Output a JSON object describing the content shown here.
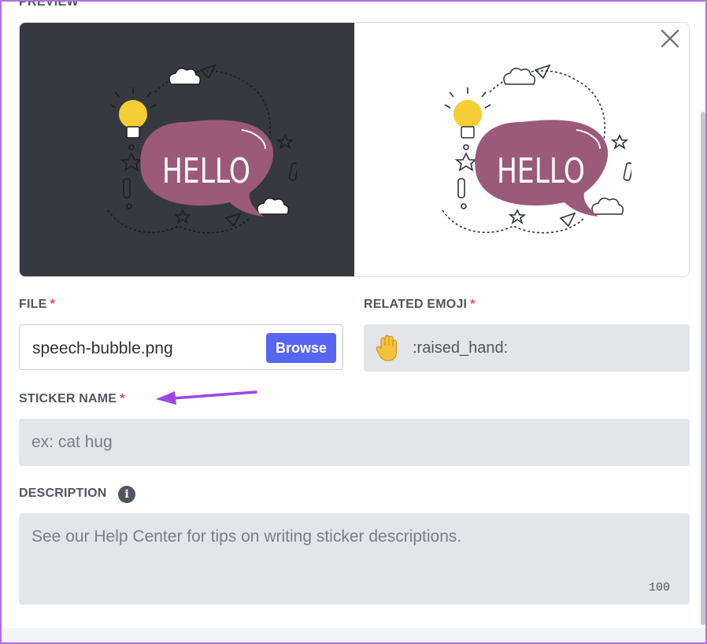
{
  "preview": {
    "heading": "PREVIEW",
    "sticker_text": "HELLO",
    "sticker_color": "#9b5a7a",
    "dark_background": "#36393f",
    "light_background": "#ffffff"
  },
  "close": {
    "icon": "close-icon"
  },
  "file": {
    "label": "FILE",
    "required_mark": "*",
    "filename": "speech-bubble.png",
    "browse_label": "Browse"
  },
  "related_emoji": {
    "label": "RELATED EMOJI",
    "required_mark": "*",
    "emoji_icon": "raised-hand-icon",
    "code": ":raised_hand:"
  },
  "sticker_name": {
    "label": "STICKER NAME",
    "required_mark": "*",
    "placeholder": "ex: cat hug"
  },
  "description": {
    "label": "DESCRIPTION",
    "info_icon": "info-icon",
    "placeholder": "See our Help Center for tips on writing sticker descriptions.",
    "char_count": "100"
  },
  "colors": {
    "accent": "#5865f2",
    "required": "#ed4245",
    "annotation_arrow": "#9b47e8",
    "field_bg": "#e3e5e8"
  }
}
